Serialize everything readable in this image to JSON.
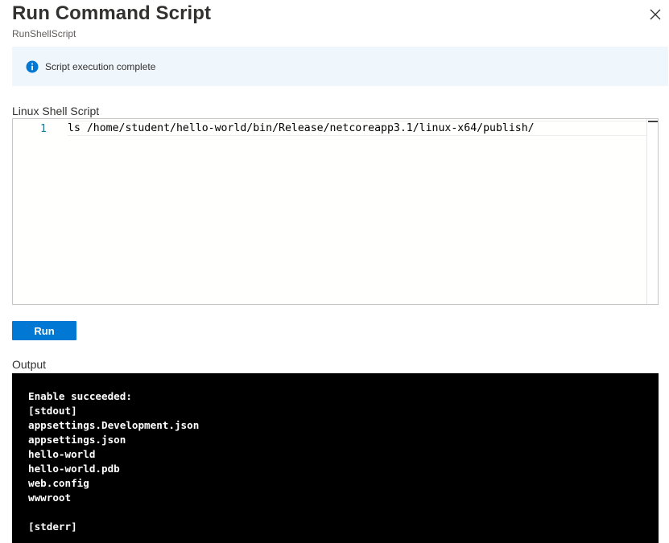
{
  "header": {
    "title": "Run Command Script",
    "subtitle": "RunShellScript",
    "close_icon": "close-icon"
  },
  "info_bar": {
    "icon": "info-icon",
    "message": "Script execution complete",
    "accent_color": "#0078d4"
  },
  "script": {
    "label": "Linux Shell Script",
    "line_number": "1",
    "code": "ls /home/student/hello-world/bin/Release/netcoreapp3.1/linux-x64/publish/"
  },
  "run_button": {
    "label": "Run",
    "color": "#0078d4"
  },
  "output": {
    "label": "Output",
    "lines": [
      "Enable succeeded:",
      "[stdout]",
      "appsettings.Development.json",
      "appsettings.json",
      "hello-world",
      "hello-world.pdb",
      "web.config",
      "wwwroot",
      "",
      "[stderr]"
    ]
  }
}
